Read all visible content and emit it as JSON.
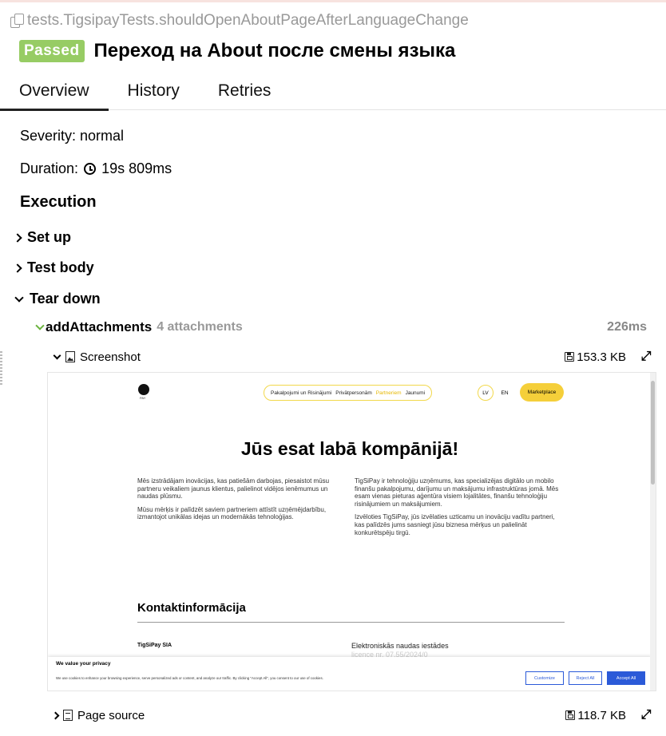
{
  "test": {
    "full_name": "tests.TigsipayTests.shouldOpenAboutPageAfterLanguageChange",
    "status": "Passed",
    "title": "Переход на About после смены языка"
  },
  "tabs": [
    "Overview",
    "History",
    "Retries"
  ],
  "overview": {
    "severity": "Severity: normal",
    "duration_label": "Duration:",
    "duration_value": "19s 809ms",
    "execution_heading": "Execution"
  },
  "steps": {
    "setup": "Set up",
    "body": "Test body",
    "teardown": "Tear down",
    "add_attachments": {
      "name": "addAttachments",
      "count": "4 attachments",
      "duration": "226ms"
    }
  },
  "attachments": [
    {
      "name": "Screenshot",
      "size": "153.3 KB",
      "icon": "image-file-icon"
    },
    {
      "name": "Page source",
      "size": "118.7 KB",
      "icon": "text-file-icon"
    }
  ],
  "screenshot": {
    "logo_text": "PAY",
    "nav": [
      "Pakalpojumi un Risinājumi",
      "Privātpersonām",
      "Partneriem",
      "Jaunumi"
    ],
    "lang_lv": "LV",
    "lang_en": "EN",
    "marketplace": "Marketplace",
    "headline": "Jūs esat labā kompānijā!",
    "left_p1": "Mēs izstrādājam inovācijas, kas patiešām darbojas, piesaistot mūsu partneru veikaliem jaunus klientus, palielinot vidējos ienēmumus un naudas plūsmu.",
    "left_p2": "Mūsu mērķis ir palīdzēt saviem partneriem attīstīt uzņēmējdarbību, izmantojot unikālas idejas un modernākās tehnoloģijas.",
    "right_p1": "TigSiPay ir tehnoloģiju uzņēmums, kas specializējas digitālo un mobilo finanšu pakalpojumu, darījumu un maksājumu infrastruktūras jomā. Mēs esam vienas pieturas aģentūra visiem lojalitātes, finanšu tehnoloģiju risinājumiem un maksājumiem.",
    "right_p2": "Izvēloties TigSiPay, jūs izvēlaties uzticamu un inovāciju vadītu partneri, kas palīdzēs jums sasniegt jūsu biznesa mērķus un palielināt konkurētspēju tirgū.",
    "contact_heading": "Kontaktinformācija",
    "company": "TigSiPay SIA",
    "institution": "Elektroniskās naudas iestādes",
    "license_partial": "licence nr. 07.55/2024/0",
    "cookie_title": "We value your privacy",
    "cookie_text": "We use cookies to enhance your browsing experience, serve personalized ads or content, and analyze our traffic. By clicking \"Accept All\", you consent to our use of cookies.",
    "btn_customize": "Customize",
    "btn_reject": "Reject All",
    "btn_accept": "Accept All"
  }
}
